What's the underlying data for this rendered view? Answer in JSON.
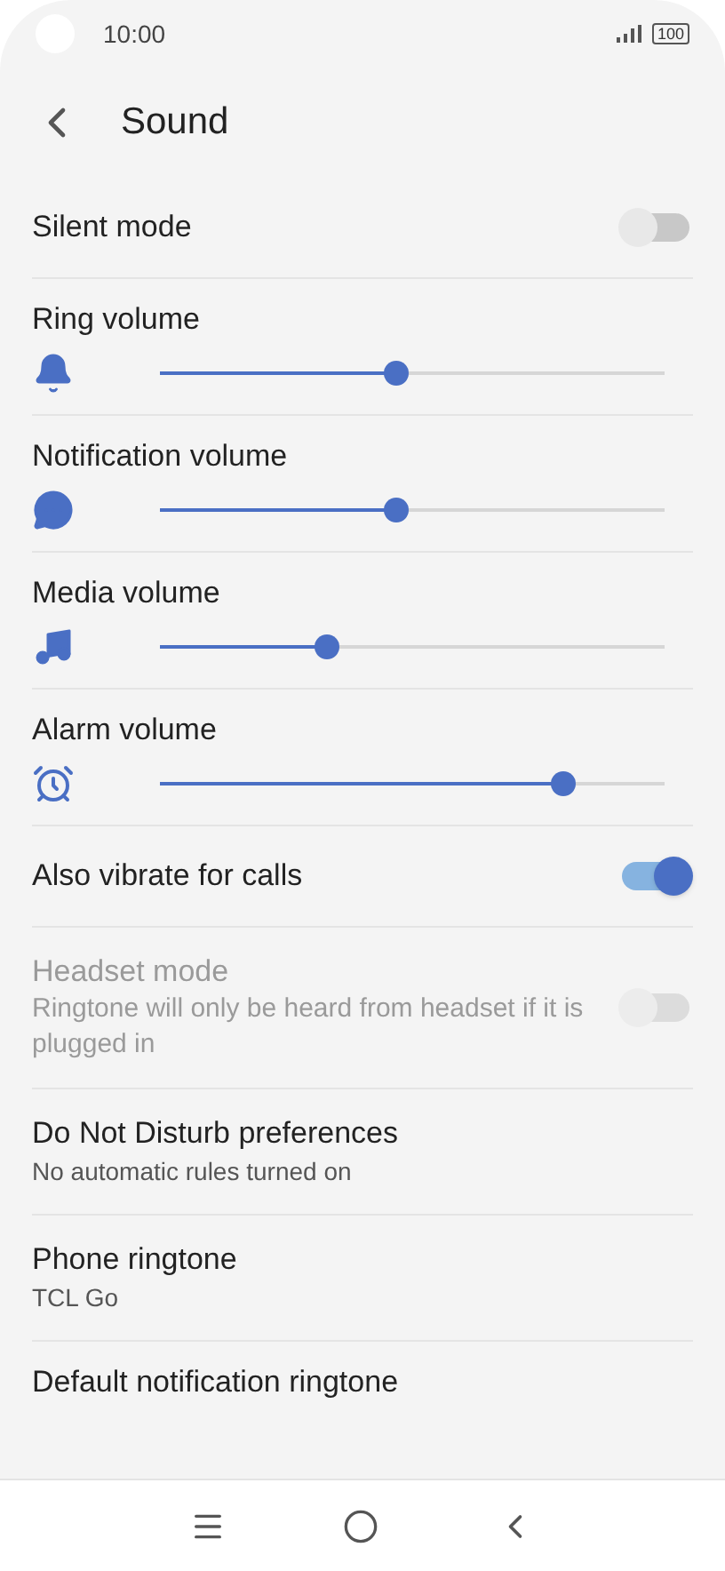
{
  "status_bar": {
    "time": "10:00",
    "battery": "100"
  },
  "header": {
    "title": "Sound"
  },
  "settings": [
    {
      "kind": "switch",
      "label": "Silent mode",
      "on": false,
      "disabled": false
    },
    {
      "kind": "volume",
      "label": "Ring volume",
      "level": 0.47
    },
    {
      "kind": "volume",
      "label": "Notification volume",
      "level": 0.47
    },
    {
      "kind": "volume",
      "label": "Media volume",
      "level": 0.33
    },
    {
      "kind": "volume",
      "label": "Alarm volume",
      "level": 0.8
    },
    {
      "kind": "switch",
      "label": "Also vibrate for calls",
      "on": true,
      "disabled": false
    },
    {
      "kind": "switch",
      "label": "Headset mode",
      "subtitle": "Ringtone will only be heard from headset if it is plugged in",
      "on": false,
      "disabled": true
    },
    {
      "kind": "link",
      "label": "Do Not Disturb preferences",
      "subtitle": "No automatic rules turned on"
    },
    {
      "kind": "link",
      "label": "Phone ringtone",
      "subtitle": "TCL Go"
    },
    {
      "kind": "link",
      "label": "Default notification ringtone"
    }
  ]
}
